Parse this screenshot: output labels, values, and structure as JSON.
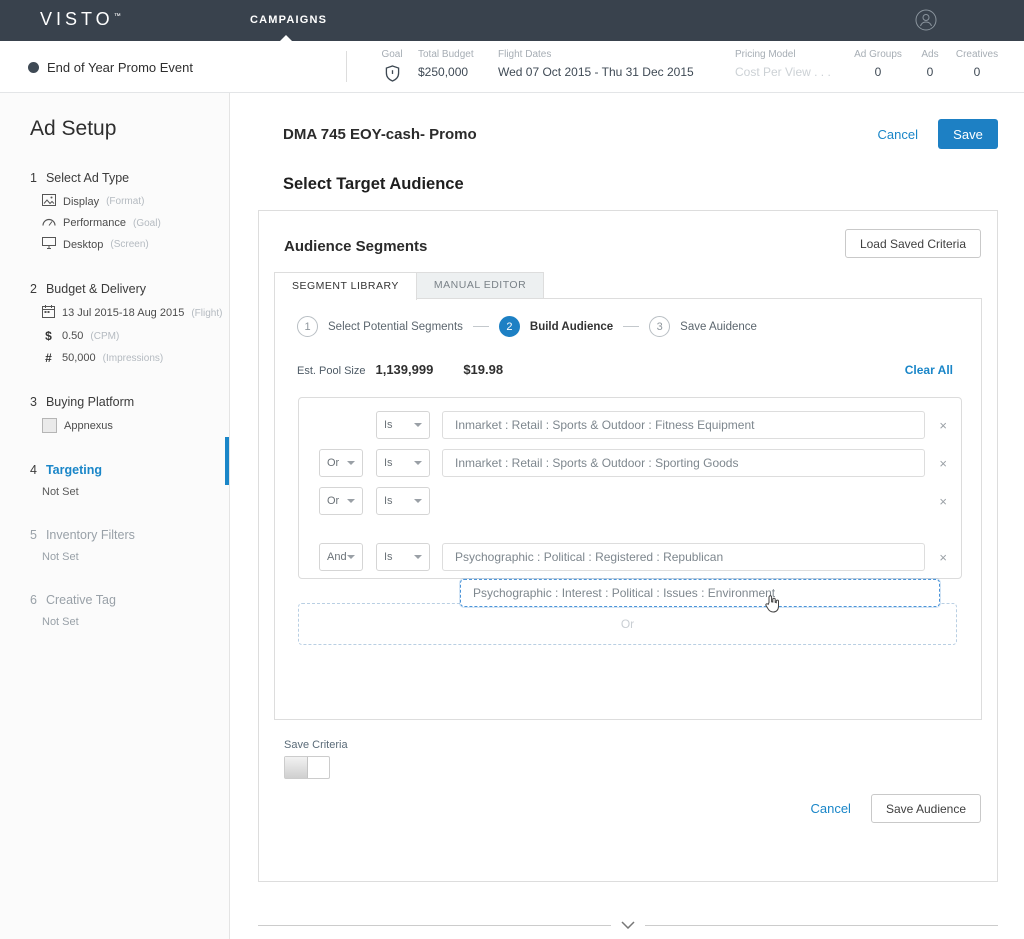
{
  "colors": {
    "accent_blue": "#1d80c4",
    "link_blue": "#1a86c8",
    "topbar_bg": "#39424d"
  },
  "icons": {
    "close": "×",
    "dollar": "$",
    "hash": "#"
  },
  "topbar": {
    "logo": "VISTO",
    "logo_tm": "™",
    "nav_campaigns": "CAMPAIGNS"
  },
  "campaign_header": {
    "name": "End of Year Promo Event",
    "goal_label": "Goal",
    "total_budget_label": "Total Budget",
    "total_budget_value": "$250,000",
    "flight_dates_label": "Flight Dates",
    "flight_dates_value": "Wed 07 Oct 2015 - Thu 31 Dec 2015",
    "pricing_model_label": "Pricing Model",
    "pricing_model_value": "Cost Per View . . .",
    "ad_groups_label": "Ad Groups",
    "ad_groups_value": "0",
    "ads_label": "Ads",
    "ads_value": "0",
    "creatives_label": "Creatives",
    "creatives_value": "0"
  },
  "sidebar": {
    "title": "Ad Setup",
    "steps": [
      {
        "num": "1",
        "label": "Select Ad Type",
        "items": [
          {
            "text": "Display",
            "suffix": "(Format)"
          },
          {
            "text": "Performance",
            "suffix": "(Goal)"
          },
          {
            "text": "Desktop",
            "suffix": "(Screen)"
          }
        ]
      },
      {
        "num": "2",
        "label": "Budget & Delivery",
        "items": [
          {
            "text": "13 Jul 2015-18 Aug 2015",
            "suffix": "(Flight)"
          },
          {
            "text": "0.50",
            "suffix": "(CPM)"
          },
          {
            "text": "50,000",
            "suffix": "(Impressions)"
          }
        ]
      },
      {
        "num": "3",
        "label": "Buying Platform",
        "items": [
          {
            "text": "Appnexus",
            "suffix": ""
          }
        ]
      },
      {
        "num": "4",
        "label": "Targeting",
        "status": "Not Set"
      },
      {
        "num": "5",
        "label": "Inventory Filters",
        "status": "Not Set"
      },
      {
        "num": "6",
        "label": "Creative Tag",
        "status": "Not Set"
      }
    ]
  },
  "main": {
    "title": "DMA 745 EOY-cash- Promo",
    "cancel_label": "Cancel",
    "save_label": "Save",
    "section_title": "Select Target Audience",
    "panel": {
      "title": "Audience Segments",
      "load_saved_label": "Load Saved Criteria",
      "tabs": [
        {
          "label": "SEGMENT LIBRARY"
        },
        {
          "label": "MANUAL EDITOR"
        }
      ],
      "stepper": [
        {
          "num": "1",
          "label": "Select Potential Segments"
        },
        {
          "num": "2",
          "label": "Build Audience"
        },
        {
          "num": "3",
          "label": "Save Auidence"
        }
      ],
      "pool": {
        "label": "Est. Pool Size",
        "size": "1,139,999",
        "price": "$19.98",
        "clear_label": "Clear All"
      },
      "rows": [
        {
          "conj": "",
          "op": "Is",
          "value": "Inmarket : Retail : Sports & Outdoor : Fitness Equipment"
        },
        {
          "conj": "Or",
          "op": "Is",
          "value": "Inmarket : Retail : Sports & Outdoor : Sporting Goods"
        },
        {
          "conj": "Or",
          "op": "Is",
          "value": ""
        },
        {
          "conj": "And",
          "op": "Is",
          "value": "Psychographic : Political : Registered : Republican"
        }
      ],
      "dragging_item": "Psychographic : Interest : Political : Issues : Environment",
      "dropzone_label": "Or",
      "save_criteria_label": "Save Criteria",
      "footer": {
        "cancel_label": "Cancel",
        "save_audience_label": "Save Audience"
      }
    }
  }
}
